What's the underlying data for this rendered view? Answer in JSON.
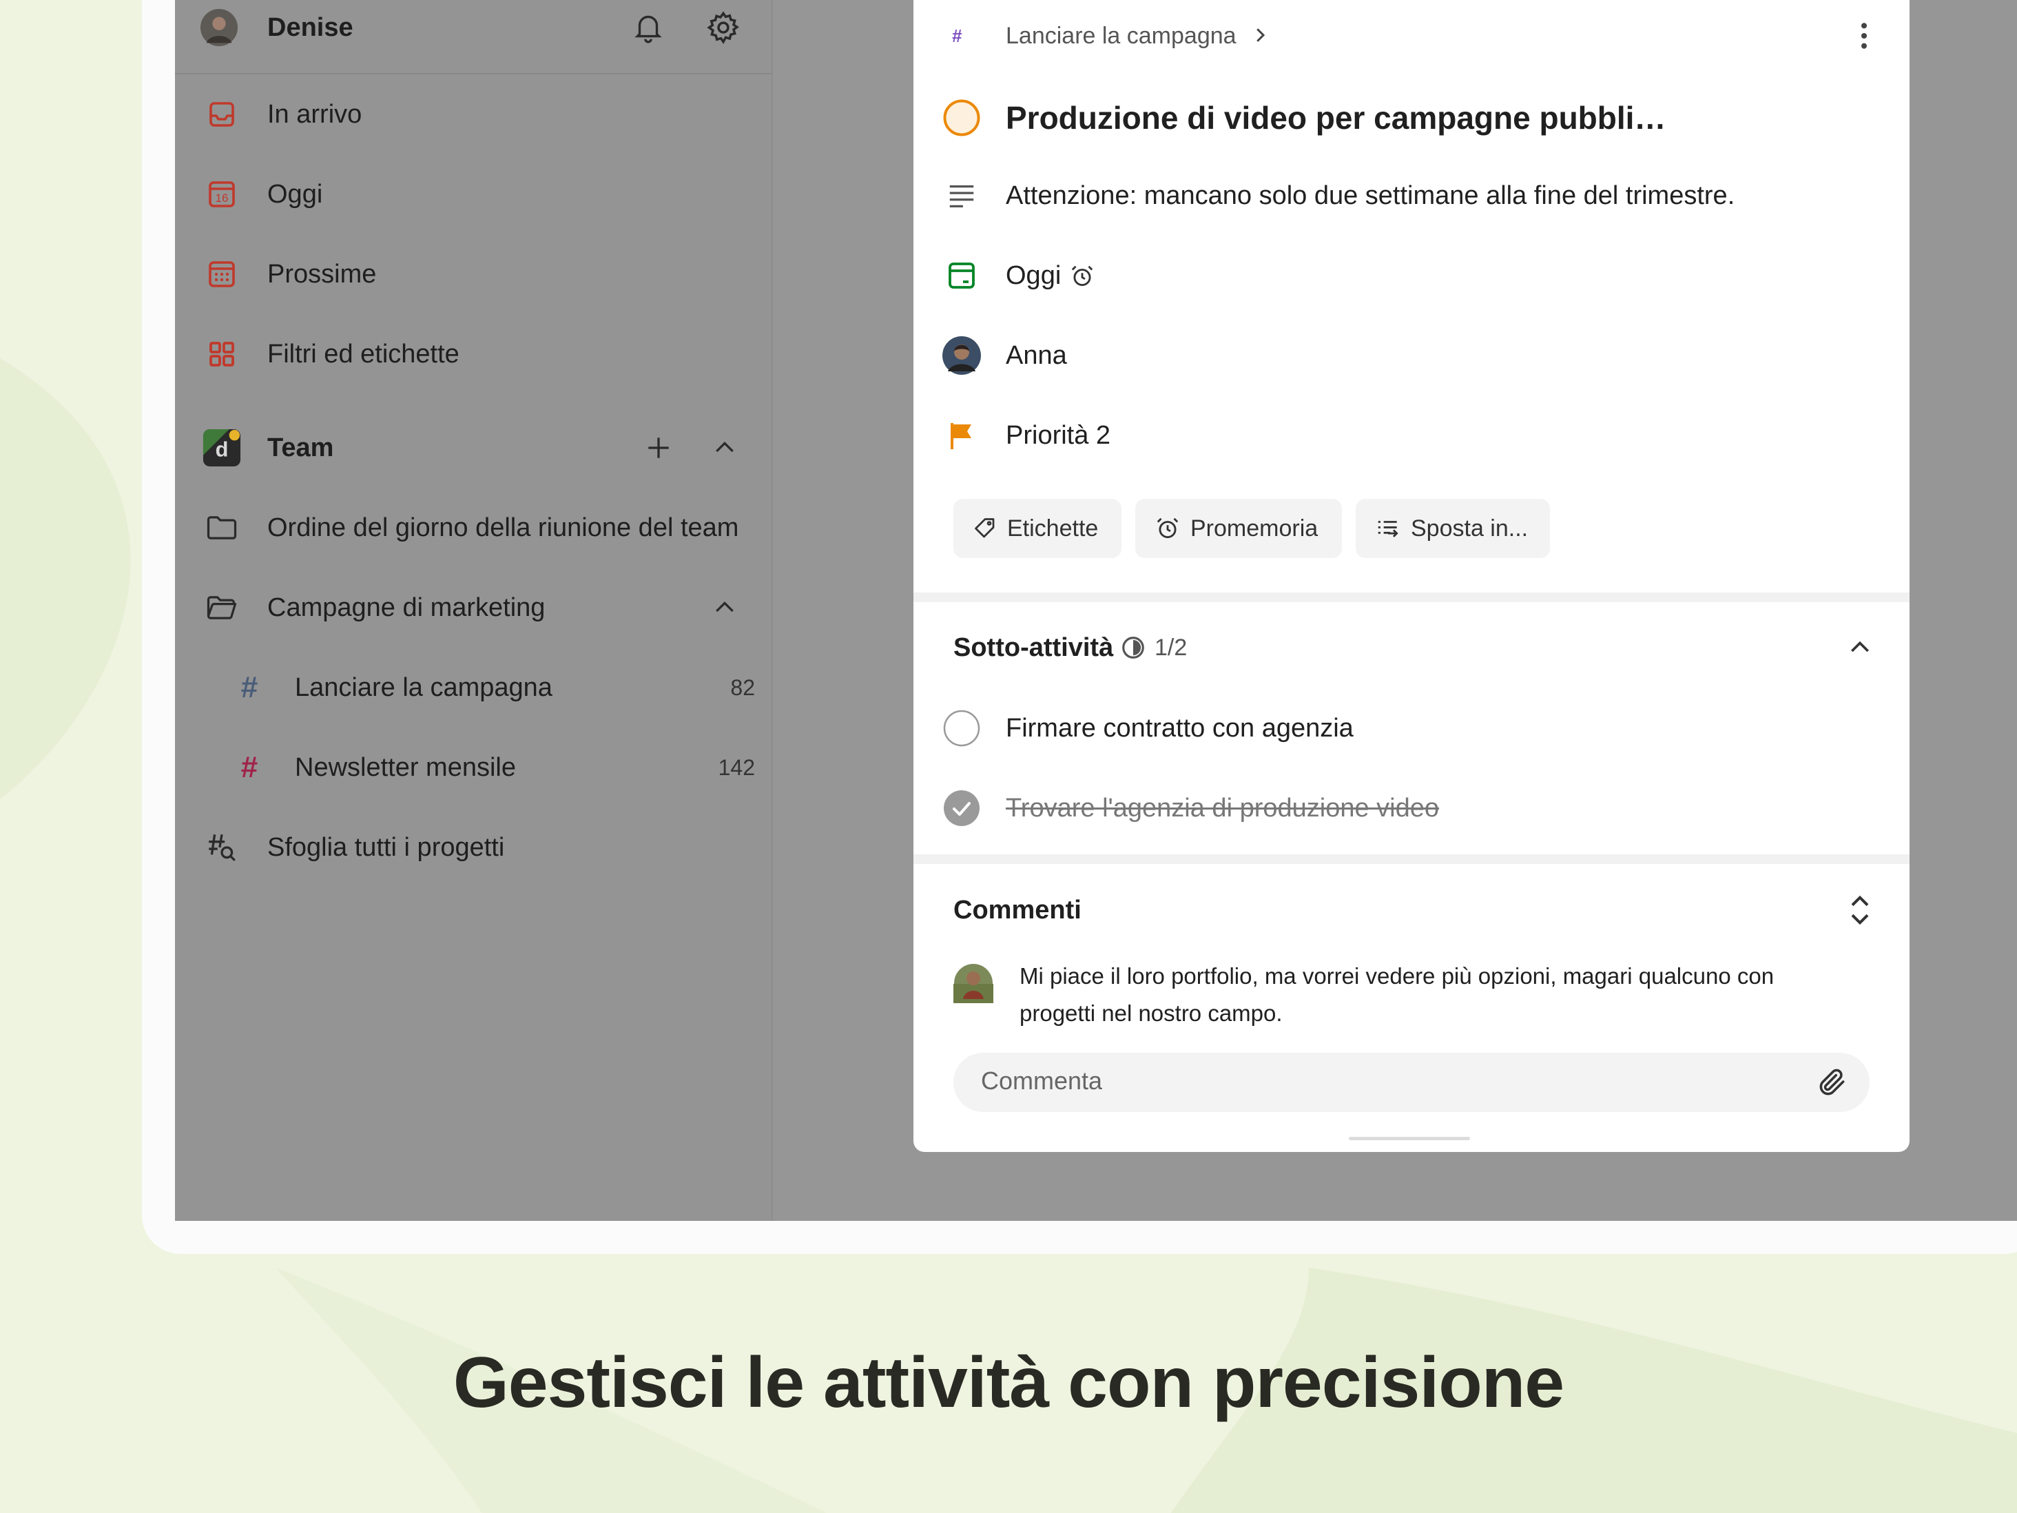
{
  "sidebar": {
    "user": {
      "name": "Denise"
    },
    "nav": [
      {
        "label": "In arrivo",
        "icon": "inbox-icon"
      },
      {
        "label": "Oggi",
        "icon": "calendar-today-icon",
        "day": "16"
      },
      {
        "label": "Prossime",
        "icon": "calendar-upcoming-icon"
      },
      {
        "label": "Filtri ed etichette",
        "icon": "filters-grid-icon"
      }
    ],
    "team": {
      "label": "Team",
      "badge": "d"
    },
    "projects": [
      {
        "label": "Ordine del giorno della riunione del team",
        "icon": "folder-icon",
        "count": ""
      },
      {
        "label": "Campagne di marketing",
        "icon": "folder-open-icon",
        "count": ""
      },
      {
        "label": "Lanciare la campagna",
        "icon": "hash-icon",
        "count": "82"
      },
      {
        "label": "Newsletter mensile",
        "icon": "hash-icon",
        "count": "142"
      }
    ],
    "browse": {
      "label": "Sfoglia tutti i progetti"
    }
  },
  "task": {
    "breadcrumb": "Lanciare la campagna",
    "breadcrumb_hash": "#",
    "title": "Produzione di video per campagne pubbli…",
    "description": "Attenzione: mancano solo due settimane alla fine del trimestre.",
    "due": "Oggi",
    "assignee": "Anna",
    "priority": "Priorità 2",
    "chips": {
      "labels": "Etichette",
      "reminders": "Promemoria",
      "move": "Sposta in..."
    },
    "subtasks": {
      "title": "Sotto-attività",
      "progress": "1/2",
      "items": [
        {
          "label": "Firmare contratto con agenzia",
          "done": false
        },
        {
          "label": "Trovare l'agenzia di produzione video",
          "done": true
        }
      ]
    },
    "comments": {
      "title": "Commenti",
      "items": [
        {
          "text_line1": "Mi piace il loro portfolio, ma vorrei vedere più opzioni, magari qualcuno con",
          "text_line2": "progetti nel nostro campo."
        }
      ],
      "placeholder": "Commenta"
    }
  },
  "headline": "Gestisci le attività con precisione",
  "colors": {
    "accent_red": "#c0392b",
    "priority_orange": "#eb8909",
    "today_green": "#058527",
    "hash_purple": "#7c4dbf",
    "background": "#eef4df"
  }
}
